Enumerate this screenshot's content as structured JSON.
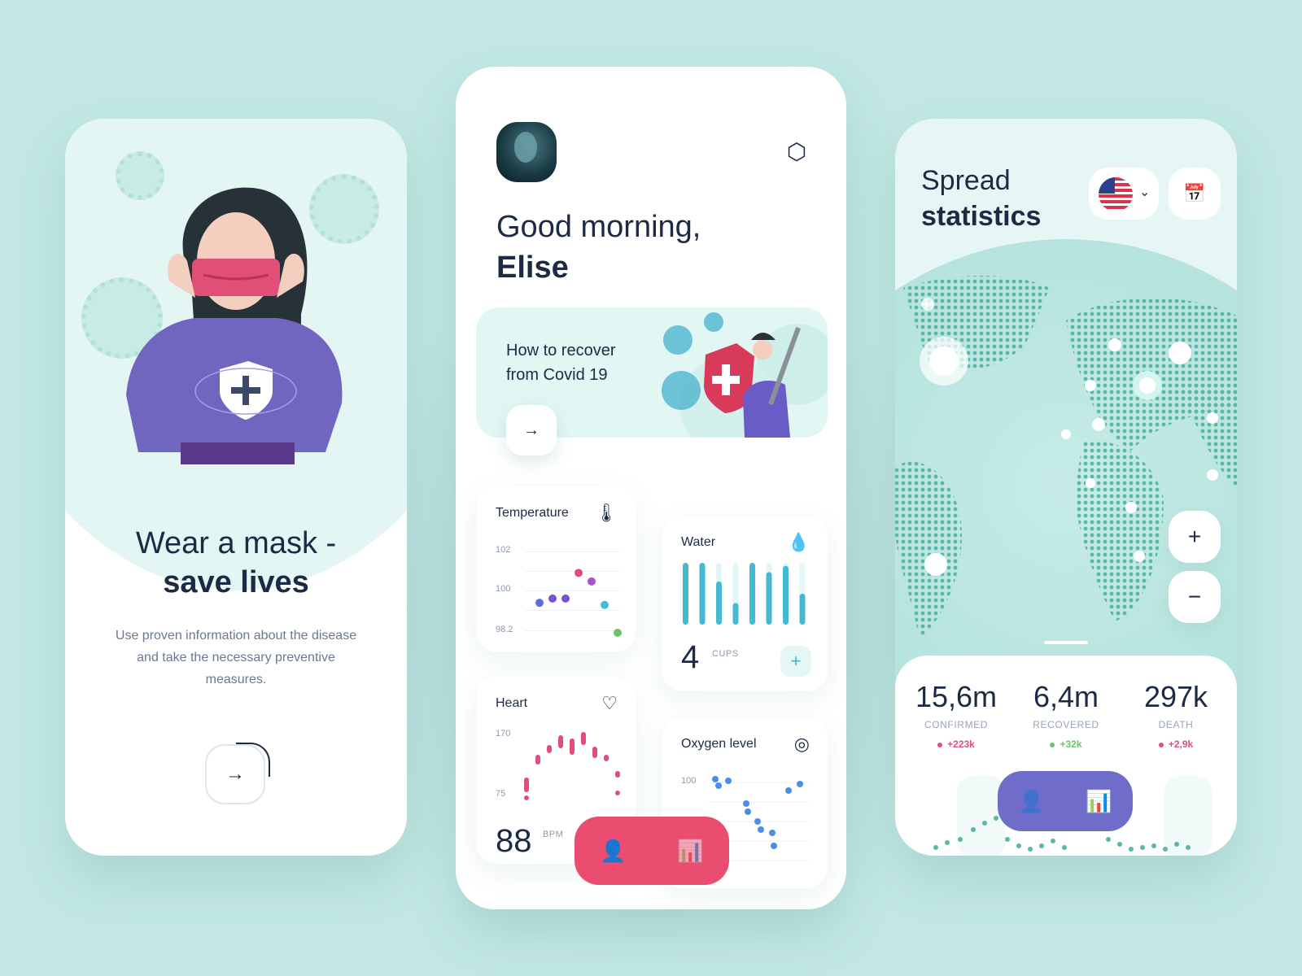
{
  "onboarding": {
    "title_line1": "Wear a mask -",
    "title_line2": "save lives",
    "description": "Use proven information about the disease and take the necessary preventive measures.",
    "next_icon": "arrow-right-icon"
  },
  "dashboard": {
    "greeting": "Good morning,",
    "user_name": "Elise",
    "banner": {
      "line1": "How to recover",
      "line2": "from Covid 19"
    },
    "temperature": {
      "label": "Temperature",
      "ticks": [
        "102",
        "100",
        "98.2"
      ],
      "readings": [
        99.6,
        99.8,
        99.8,
        101.0,
        100.6,
        99.5,
        98.2
      ],
      "colors": [
        "#5a6fdc",
        "#7b52c9",
        "#7b52c9",
        "#e14e78",
        "#a357c9",
        "#3fc0d0",
        "#6bc36a"
      ]
    },
    "water": {
      "label": "Water",
      "value": "4",
      "unit": "CUPS",
      "bars": [
        1.0,
        1.0,
        0.7,
        0.35,
        1.0,
        0.85,
        0.95,
        0.5
      ],
      "color": "#45b9d1"
    },
    "heart": {
      "label": "Heart",
      "ticks": [
        "170",
        "75"
      ],
      "value": "88",
      "unit": "BPM",
      "color": "#e14e78"
    },
    "oxygen": {
      "label": "Oxygen level",
      "ticks": [
        "100"
      ],
      "color": "#4a8ee8"
    },
    "tab_icons": [
      "user-icon",
      "stats-icon"
    ],
    "accent": "#ea4d6f"
  },
  "statistics": {
    "title_line1": "Spread",
    "title_line2": "statistics",
    "country_flag": "usa-flag-icon",
    "stats": [
      {
        "value": "15,6m",
        "label": "CONFIRMED",
        "delta": "+223k",
        "color": "#e14e78"
      },
      {
        "value": "6,4m",
        "label": "RECOVERED",
        "delta": "+32k",
        "color": "#6bc36a"
      },
      {
        "value": "297k",
        "label": "DEATH",
        "delta": "+2,9k",
        "color": "#e14e78"
      }
    ],
    "zoom_in": "+",
    "zoom_out": "−",
    "accent": "#6f6dc9"
  }
}
